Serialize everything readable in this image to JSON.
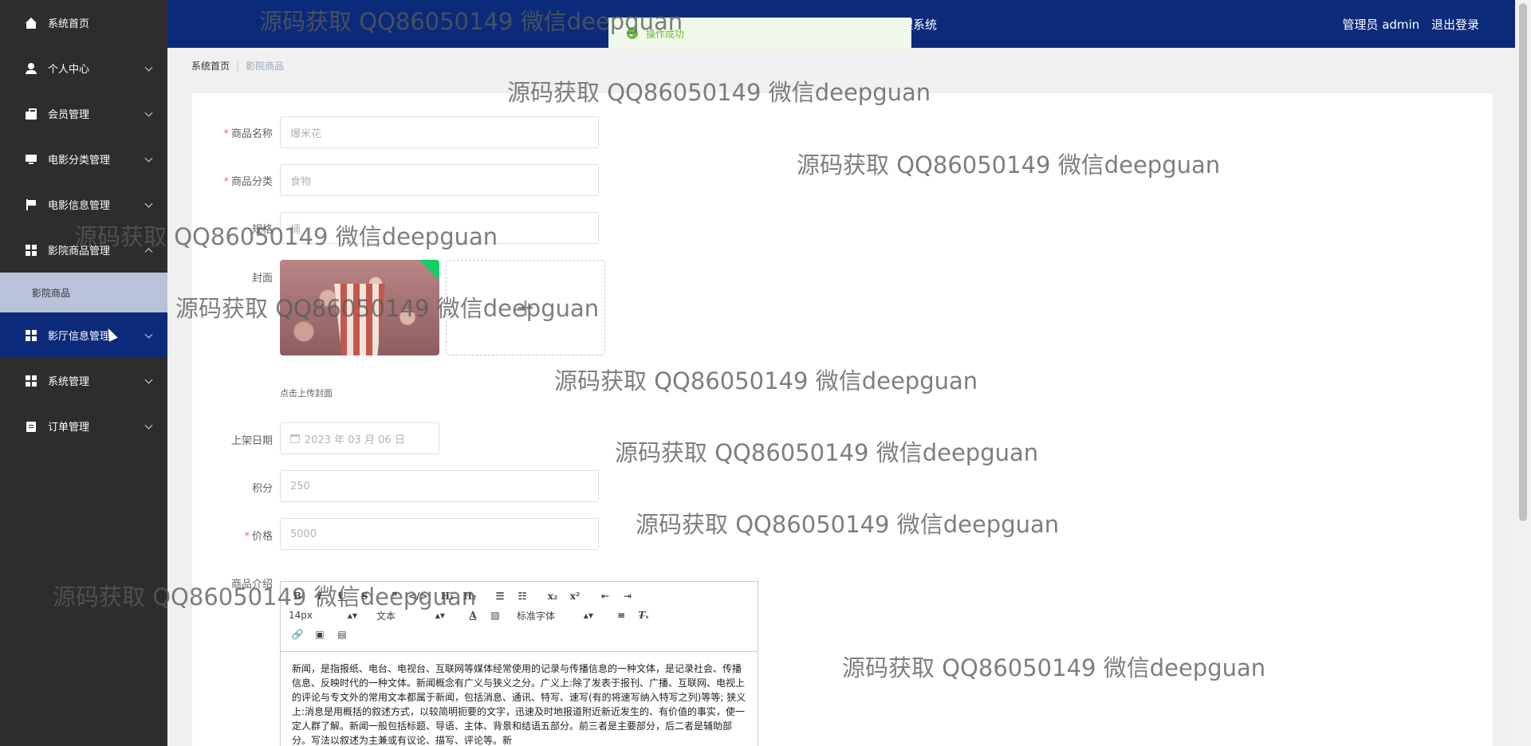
{
  "sidebar": {
    "items": [
      {
        "label": "系统首页",
        "icon": "home-icon"
      },
      {
        "label": "个人中心",
        "icon": "user-icon"
      },
      {
        "label": "会员管理",
        "icon": "briefcase-icon"
      },
      {
        "label": "电影分类管理",
        "icon": "monitor-icon"
      },
      {
        "label": "电影信息管理",
        "icon": "flag-icon"
      },
      {
        "label": "影院商品管理",
        "icon": "grid-icon",
        "expanded": true
      },
      {
        "label": "影厅信息管理",
        "icon": "grid-icon"
      },
      {
        "label": "系统管理",
        "icon": "grid-icon"
      },
      {
        "label": "订单管理",
        "icon": "clipboard-icon"
      }
    ],
    "submenu": {
      "label": "影院商品"
    }
  },
  "header": {
    "title": "理系统",
    "user": "管理员 admin",
    "logout": "退出登录"
  },
  "toast": {
    "message": "操作成功"
  },
  "breadcrumb": {
    "home": "系统首页",
    "current": "影院商品"
  },
  "form": {
    "name": {
      "label": "商品名称",
      "value": "爆米花"
    },
    "category": {
      "label": "商品分类",
      "value": "食物"
    },
    "spec": {
      "label": "规格",
      "value": "桶"
    },
    "cover": {
      "label": "封面",
      "tip": "点击上传封面"
    },
    "date": {
      "label": "上架日期",
      "value": "2023 年 03 月 06 日"
    },
    "points": {
      "label": "积分",
      "value": "250"
    },
    "price": {
      "label": "价格",
      "value": "5000"
    },
    "intro": {
      "label": "商品介绍"
    }
  },
  "editor": {
    "font_size": "14px",
    "text_type": "文本",
    "font_family": "标准字体",
    "content": "新闻，是指报纸、电台、电视台、互联网等媒体经常使用的记录与传播信息的一种文体，是记录社会、传播信息、反映时代的一种文体。新闻概念有广义与狭义之分。广义上:除了发表于报刊、广播、互联网、电视上的评论与专文外的常用文本都属于新闻，包括消息、通讯、特写、速写(有的将速写纳入特写之列)等等; 狭义上:消息是用概括的叙述方式，以较简明扼要的文字，迅速及时地报道附近新近发生的、有价值的事实，使一定人群了解。新闻一般包括标题、导语、主体、背景和结语五部分。前三者是主要部分，后二者是辅助部分。写法以叙述为主兼或有议论、描写、评论等。新"
  },
  "watermark": "源码获取 QQ86050149 微信deepguan"
}
